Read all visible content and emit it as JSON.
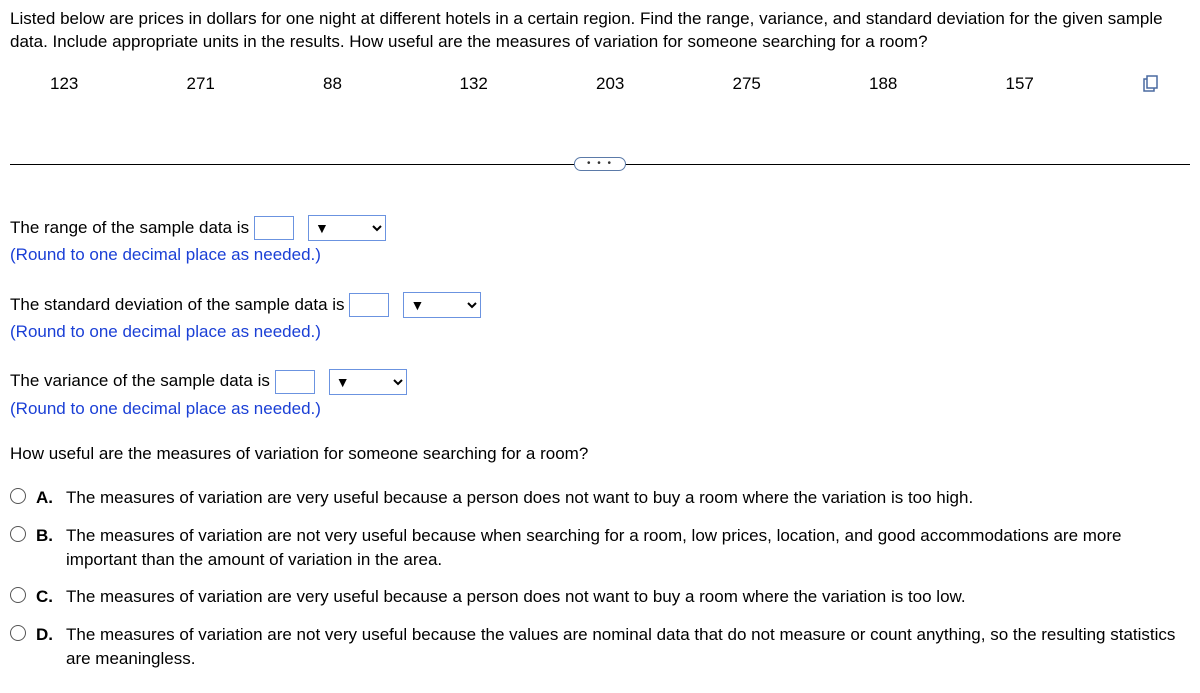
{
  "intro": "Listed below are prices in dollars for one night at different hotels in a certain region. Find the range, variance, and standard deviation for the given sample data. Include appropriate units in the results. How useful are the measures of variation for someone searching for a room?",
  "data_values": [
    "123",
    "271",
    "88",
    "132",
    "203",
    "275",
    "188",
    "157"
  ],
  "ellipsis": "• • •",
  "range": {
    "label_pre": "The range of the sample data is ",
    "value": "",
    "hint": "(Round to one decimal place as needed.)"
  },
  "stddev": {
    "label_pre": "The standard deviation of the sample data is ",
    "value": "",
    "hint": "(Round to one decimal place as needed.)"
  },
  "variance": {
    "label_pre": "The variance of the sample data is ",
    "value": "",
    "hint": "(Round to one decimal place as needed.)"
  },
  "follow_question": "How useful are the measures of variation for someone searching for a room?",
  "options": [
    {
      "letter": "A.",
      "text": "The measures of variation are very useful because a person does not want to buy a room where the variation is too high."
    },
    {
      "letter": "B.",
      "text": "The measures of variation are not very useful because when searching for a room, low prices, location, and good accommodations are more important than the amount of variation in the area."
    },
    {
      "letter": "C.",
      "text": "The measures of variation are very useful because a person does not want to buy a room where the variation is too low."
    },
    {
      "letter": "D.",
      "text": "The measures of variation are not very useful because the values are nominal data that do not measure or count anything, so the resulting statistics are meaningless."
    }
  ],
  "dropdown_arrow": "▼"
}
